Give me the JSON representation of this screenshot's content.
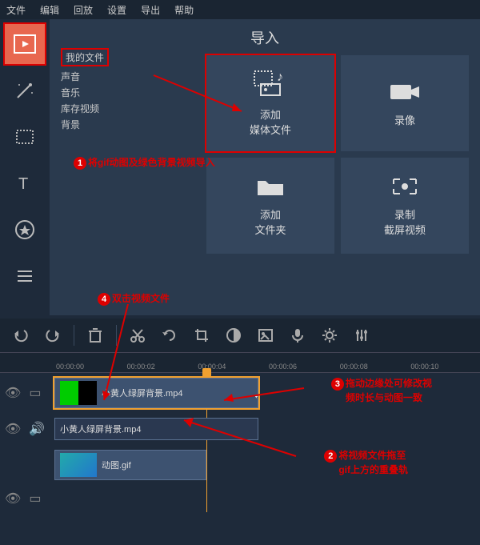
{
  "menu": {
    "file": "文件",
    "edit": "编辑",
    "playback": "回放",
    "settings": "设置",
    "export": "导出",
    "help": "帮助"
  },
  "import": {
    "title": "导入",
    "tree": {
      "myfiles": "我的文件",
      "sound": "声音",
      "music": "音乐",
      "stock": "库存视频",
      "background": "背景"
    },
    "cards": {
      "addMedia1": "添加",
      "addMedia2": "媒体文件",
      "record": "录像",
      "addFolder1": "添加",
      "addFolder2": "文件夹",
      "screenRec1": "录制",
      "screenRec2": "截屏视频"
    }
  },
  "annotations": {
    "a1": "将gif动图及绿色背景视频导入",
    "a2_1": "将视频文件拖至",
    "a2_2": "gif上方的重叠轨",
    "a3_1": "拖动边缘处可修改视",
    "a3_2": "频时长与动图一致",
    "a4": "双击视频文件"
  },
  "ruler": [
    "00:00:00",
    "00:00:02",
    "00:00:04",
    "00:00:06",
    "00:00:08",
    "00:00:10"
  ],
  "clips": {
    "overlay": "小黄人绿屏背景.mp4",
    "audio": "小黄人绿屏背景.mp4",
    "gif": "动图.gif"
  }
}
